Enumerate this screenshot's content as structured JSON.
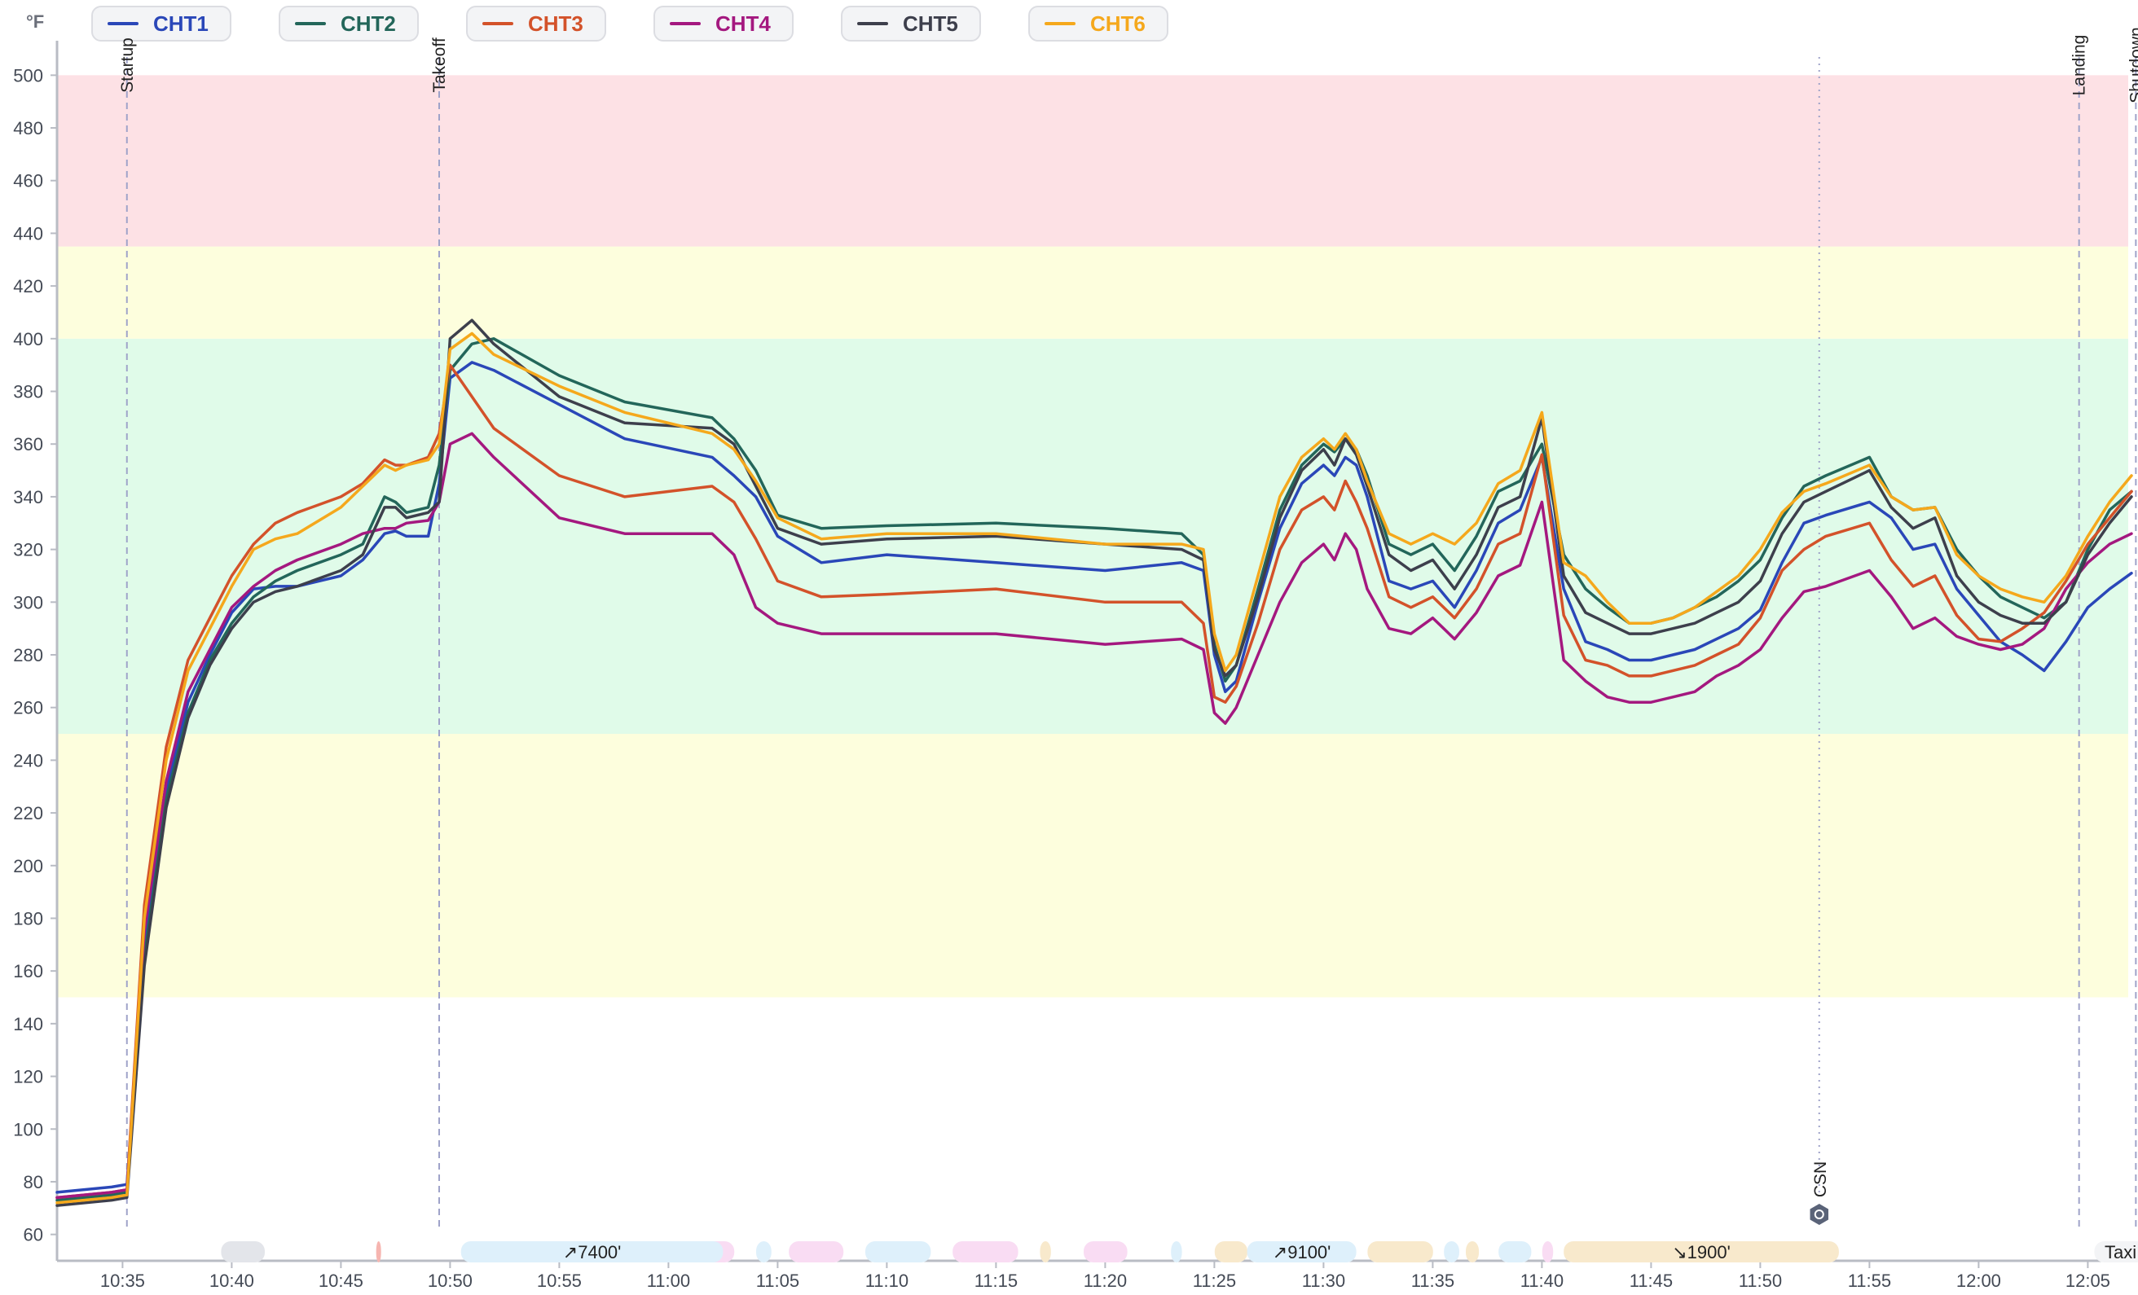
{
  "unit": "°F",
  "legend": [
    {
      "name": "CHT1",
      "color": "#2a47b8"
    },
    {
      "name": "CHT2",
      "color": "#23665a"
    },
    {
      "name": "CHT3",
      "color": "#d3522a"
    },
    {
      "name": "CHT4",
      "color": "#a4187f"
    },
    {
      "name": "CHT5",
      "color": "#3d3f4c"
    },
    {
      "name": "CHT6",
      "color": "#f5a81c"
    }
  ],
  "chart_data": {
    "type": "line",
    "ylabel": "°F",
    "ylim": [
      50,
      510
    ],
    "xlim": [
      "10:32",
      "12:07"
    ],
    "grid": false,
    "legend_placement": "top",
    "y_ticks": [
      60,
      80,
      100,
      120,
      140,
      160,
      180,
      200,
      220,
      240,
      260,
      280,
      300,
      320,
      340,
      360,
      380,
      400,
      420,
      440,
      460,
      480,
      500
    ],
    "x_ticks": [
      "10:35",
      "10:40",
      "10:45",
      "10:50",
      "10:55",
      "11:00",
      "11:05",
      "11:10",
      "11:15",
      "11:20",
      "11:25",
      "11:30",
      "11:35",
      "11:40",
      "11:45",
      "11:50",
      "11:55",
      "12:00",
      "12:05"
    ],
    "bands": [
      {
        "from": 150,
        "to": 250,
        "color": "#fdfedd"
      },
      {
        "from": 250,
        "to": 400,
        "color": "#e0fbe9"
      },
      {
        "from": 400,
        "to": 435,
        "color": "#fdfedd"
      },
      {
        "from": 435,
        "to": 500,
        "color": "#fde1e5"
      }
    ],
    "events": [
      {
        "label": "Startup",
        "time": "10:35.2"
      },
      {
        "label": "Takeoff",
        "time": "10:49.5"
      },
      {
        "label": "Landing",
        "time": "12:04.6"
      },
      {
        "label": "Shutdown",
        "time": "12:07.2"
      }
    ],
    "marker": {
      "label": "CSN",
      "time": "11:52.7"
    },
    "phases": [
      {
        "label": "↗7400'",
        "start": "10:50.5",
        "end": "11:02.5",
        "color": "#def0fb"
      },
      {
        "label": "↗9100'",
        "start": "11:26.5",
        "end": "11:31.5",
        "color": "#def0fb"
      },
      {
        "label": "↘1900'",
        "start": "11:41.0",
        "end": "11:53.6",
        "color": "#f8e9cc"
      },
      {
        "label": "Taxi",
        "start": "12:05.3",
        "end": "12:07.7",
        "color": "#f3f4f6"
      }
    ],
    "x": [
      "10:32",
      "10:34.5",
      "10:35.2",
      "10:36",
      "10:37",
      "10:38",
      "10:39",
      "10:40",
      "10:41",
      "10:42",
      "10:43",
      "10:45",
      "10:46",
      "10:47",
      "10:47.5",
      "10:48",
      "10:49",
      "10:49.5",
      "10:50",
      "10:51",
      "10:52",
      "10:55",
      "10:58",
      "11:02",
      "11:03",
      "11:04",
      "11:05",
      "11:07",
      "11:10",
      "11:15",
      "11:20",
      "11:23.5",
      "11:24.5",
      "11:25",
      "11:25.5",
      "11:26",
      "11:27",
      "11:28",
      "11:29",
      "11:30",
      "11:30.5",
      "11:31",
      "11:31.5",
      "11:32",
      "11:33",
      "11:34",
      "11:35",
      "11:36",
      "11:37",
      "11:38",
      "11:39",
      "11:40",
      "11:41",
      "11:42",
      "11:43",
      "11:44",
      "11:45",
      "11:46",
      "11:47",
      "11:48",
      "11:49",
      "11:50",
      "11:51",
      "11:52",
      "11:53",
      "11:55",
      "11:56",
      "11:57",
      "11:58",
      "11:59",
      "12:00",
      "12:01",
      "12:02",
      "12:03",
      "12:04",
      "12:05",
      "12:06",
      "12:07"
    ],
    "series": [
      {
        "name": "CHT1",
        "values": [
          76,
          78,
          79,
          170,
          228,
          262,
          280,
          296,
          305,
          306,
          306,
          310,
          316,
          326,
          327,
          325,
          325,
          345,
          385,
          391,
          388,
          375,
          362,
          355,
          348,
          340,
          325,
          315,
          318,
          315,
          312,
          315,
          312,
          280,
          266,
          270,
          300,
          328,
          345,
          352,
          348,
          355,
          352,
          340,
          308,
          305,
          308,
          298,
          312,
          330,
          335,
          355,
          305,
          285,
          282,
          278,
          278,
          280,
          282,
          286,
          290,
          297,
          315,
          330,
          333,
          338,
          332,
          320,
          322,
          305,
          295,
          285,
          280,
          274,
          285,
          298,
          305,
          311
        ]
      },
      {
        "name": "CHT2",
        "values": [
          73,
          75,
          76,
          165,
          225,
          258,
          278,
          292,
          302,
          308,
          312,
          318,
          322,
          340,
          338,
          334,
          336,
          352,
          388,
          398,
          400,
          386,
          376,
          370,
          362,
          350,
          333,
          328,
          329,
          330,
          328,
          326,
          318,
          284,
          270,
          276,
          305,
          335,
          352,
          360,
          357,
          362,
          358,
          348,
          322,
          318,
          322,
          312,
          325,
          342,
          346,
          360,
          318,
          305,
          298,
          292,
          292,
          294,
          298,
          302,
          308,
          316,
          332,
          344,
          348,
          355,
          340,
          335,
          336,
          320,
          310,
          302,
          298,
          294,
          300,
          320,
          335,
          342
        ]
      },
      {
        "name": "CHT3",
        "values": [
          74,
          76,
          77,
          185,
          245,
          278,
          294,
          310,
          322,
          330,
          334,
          340,
          345,
          354,
          352,
          352,
          355,
          364,
          390,
          378,
          366,
          348,
          340,
          344,
          338,
          324,
          308,
          302,
          303,
          305,
          300,
          300,
          292,
          264,
          262,
          268,
          292,
          320,
          335,
          340,
          335,
          346,
          338,
          328,
          302,
          298,
          302,
          294,
          305,
          322,
          326,
          356,
          295,
          278,
          276,
          272,
          272,
          274,
          276,
          280,
          284,
          294,
          312,
          320,
          325,
          330,
          316,
          306,
          310,
          295,
          286,
          285,
          290,
          296,
          308,
          322,
          332,
          342
        ]
      },
      {
        "name": "CHT4",
        "values": [
          74,
          76,
          77,
          175,
          232,
          266,
          282,
          298,
          306,
          312,
          316,
          322,
          326,
          328,
          328,
          330,
          331,
          338,
          360,
          364,
          355,
          332,
          326,
          326,
          318,
          298,
          292,
          288,
          288,
          288,
          284,
          286,
          282,
          258,
          254,
          260,
          280,
          300,
          315,
          322,
          316,
          326,
          320,
          305,
          290,
          288,
          294,
          286,
          296,
          310,
          314,
          338,
          278,
          270,
          264,
          262,
          262,
          264,
          266,
          272,
          276,
          282,
          294,
          304,
          306,
          312,
          302,
          290,
          294,
          287,
          284,
          282,
          284,
          290,
          305,
          315,
          322,
          326
        ]
      },
      {
        "name": "CHT5",
        "values": [
          71,
          73,
          74,
          162,
          222,
          256,
          276,
          290,
          300,
          304,
          306,
          312,
          318,
          336,
          336,
          332,
          334,
          338,
          400,
          407,
          398,
          378,
          368,
          366,
          360,
          344,
          328,
          322,
          324,
          325,
          322,
          320,
          316,
          282,
          272,
          276,
          302,
          332,
          350,
          358,
          352,
          362,
          356,
          344,
          318,
          312,
          316,
          305,
          318,
          336,
          340,
          370,
          310,
          296,
          292,
          288,
          288,
          290,
          292,
          296,
          300,
          308,
          326,
          338,
          342,
          350,
          336,
          328,
          332,
          310,
          300,
          295,
          292,
          292,
          300,
          318,
          330,
          340
        ]
      },
      {
        "name": "CHT6",
        "values": [
          72,
          74,
          75,
          180,
          240,
          274,
          290,
          306,
          320,
          324,
          326,
          336,
          344,
          352,
          350,
          352,
          354,
          360,
          396,
          402,
          394,
          382,
          372,
          364,
          358,
          346,
          332,
          324,
          326,
          326,
          322,
          322,
          320,
          288,
          274,
          280,
          310,
          340,
          355,
          362,
          358,
          364,
          358,
          346,
          326,
          322,
          326,
          322,
          330,
          345,
          350,
          372,
          315,
          310,
          300,
          292,
          292,
          294,
          298,
          304,
          310,
          320,
          334,
          342,
          345,
          352,
          340,
          335,
          336,
          318,
          310,
          305,
          302,
          300,
          310,
          325,
          338,
          348
        ]
      }
    ]
  }
}
